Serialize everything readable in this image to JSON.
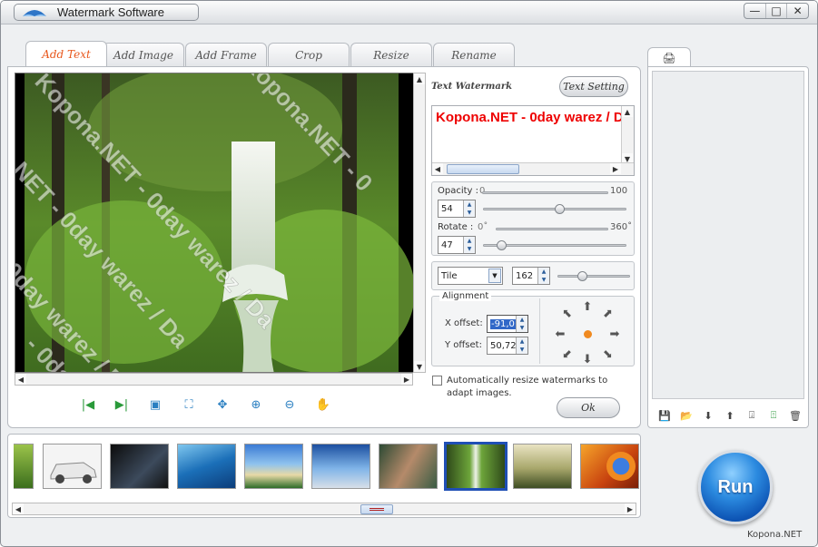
{
  "window": {
    "title": "Watermark Software",
    "buttons": [
      "—",
      "□",
      "✕"
    ]
  },
  "tabs": [
    {
      "label": "Add Text",
      "active": true
    },
    {
      "label": "Add Image",
      "active": false
    },
    {
      "label": "Add Frame",
      "active": false
    },
    {
      "label": "Crop",
      "active": false
    },
    {
      "label": "Resize",
      "active": false
    },
    {
      "label": "Rename",
      "active": false
    }
  ],
  "preview": {
    "watermark_overlay": "Kopona.NET - 0day warez / Da",
    "watermark_overlay_fragments": [
      "Kopona.NET - 0day warez / Da",
      "na.NET - 0day warez / Da",
      "T - 0day warez / Da",
      "Kopona.NET - 0",
      "- 0day"
    ]
  },
  "text_watermark": {
    "label": "Text Watermark",
    "text_setting_button": "Text Setting",
    "text": "Kopona.NET - 0day warez / Da",
    "text_color": "#e00000"
  },
  "opacity": {
    "label": "Opacity :",
    "min": "0",
    "max": "100",
    "value": "54",
    "level": 0.54
  },
  "rotate": {
    "label": "Rotate :",
    "min": "0˚",
    "max": "360˚",
    "value": "47",
    "level": 0.13
  },
  "tile": {
    "mode": "Tile",
    "value": "162",
    "level": 0.35
  },
  "alignment": {
    "label": "Alignment",
    "x_label": "X offset:",
    "x_value": "-91,0",
    "y_label": "Y offset:",
    "y_value": "50,72"
  },
  "auto_resize": {
    "label": "Automatically resize watermarks to adapt images.",
    "checked": false
  },
  "ok_button": "Ok",
  "run_button": "Run",
  "brand": "Kopona.NET",
  "accent_color": "#e8571c",
  "selection_color": "#1f4fb5",
  "thumbnails": [
    "forest-edge",
    "white-suv",
    "dark-scene",
    "ocean-wave",
    "tropical-beach",
    "blue-boat",
    "woman-rocks",
    "waterfall-forest",
    "misty-sunrise",
    "firefox-logo"
  ],
  "selected_thumbnail": 7
}
